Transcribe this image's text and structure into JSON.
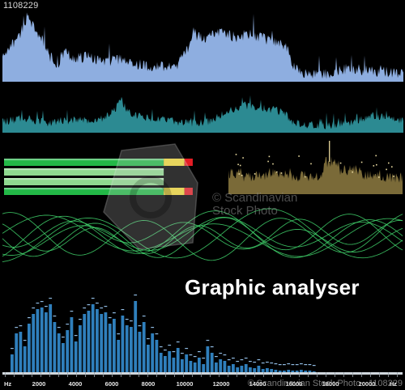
{
  "image_id_label": "1108229",
  "title": "Graphic analyser",
  "watermark": {
    "line1": "© Scandinavian",
    "line2": "Stock Photo",
    "bottom": "© Scandinavian Stock Photo · 1108229"
  },
  "colors": {
    "background": "#000000",
    "spectrum_top": "#8eaee0",
    "spectrum_mid": "#2c8a92",
    "meter_bar": "#23b847",
    "meter_bar_light": "#8fd98f",
    "meter_yellow": "#f1d93a",
    "meter_red": "#e41d25",
    "histogram_brown": "#7a6a38",
    "wave_green": "#3fd06a",
    "eq_bar": "#2f7fbc",
    "eq_peak": "#8fb9e0"
  },
  "icons": [
    "watermark-camera-icon"
  ],
  "frequency_axis": {
    "unit_left": "Hz",
    "unit_right": "Hz",
    "ticks": [
      "2000",
      "4000",
      "6000",
      "8000",
      "10000",
      "12000",
      "14000",
      "16000",
      "18000",
      "20000"
    ]
  },
  "level_meters": [
    {
      "green": 0.77,
      "yellow": 0.1,
      "red": 0.04
    },
    {
      "green": 0.77,
      "yellow": 0,
      "red": 0
    },
    {
      "green": 0.77,
      "yellow": 0,
      "red": 0
    },
    {
      "green": 0.77,
      "yellow": 0.1,
      "red": 0.04
    }
  ]
}
